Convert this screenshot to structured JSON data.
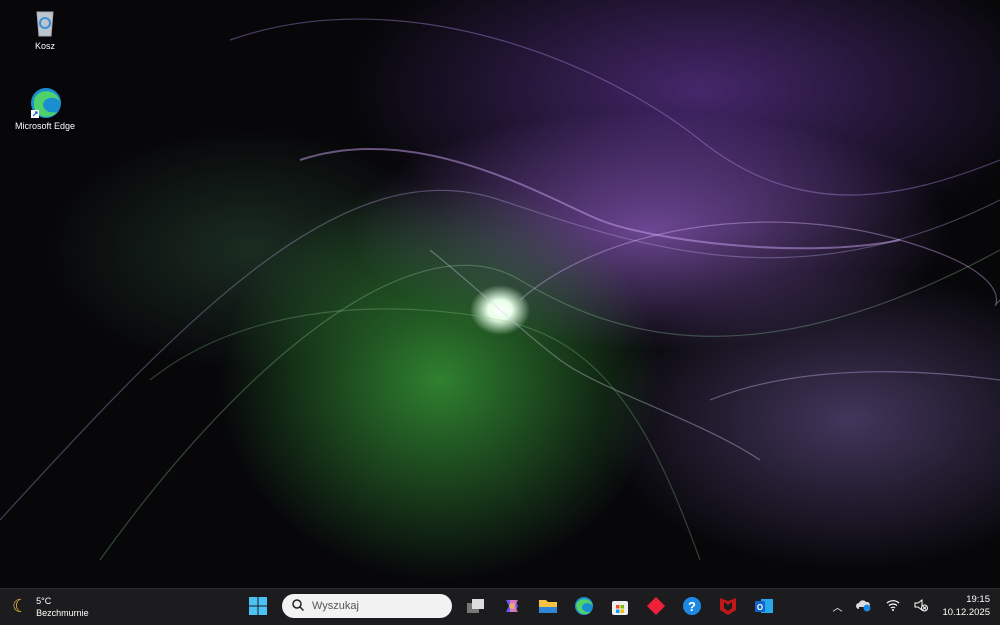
{
  "desktop": {
    "icons": [
      {
        "label": "Kosz",
        "icon": "recycle-bin-icon"
      },
      {
        "label": "Microsoft Edge",
        "icon": "edge-icon"
      }
    ]
  },
  "taskbar": {
    "weather": {
      "temp": "5°C",
      "condition": "Bezchmurnie",
      "icon": "moon-icon"
    },
    "search": {
      "placeholder": "Wyszukaj"
    },
    "apps": [
      "start",
      "task-view",
      "copilot",
      "file-explorer",
      "edge",
      "store",
      "app-red-diamond",
      "help",
      "mcafee",
      "outlook"
    ],
    "clock": {
      "time": "19:15",
      "date": "10.12.2025"
    }
  },
  "colors": {
    "taskbar": "#1c1c1e",
    "accent": "#0078d4"
  }
}
